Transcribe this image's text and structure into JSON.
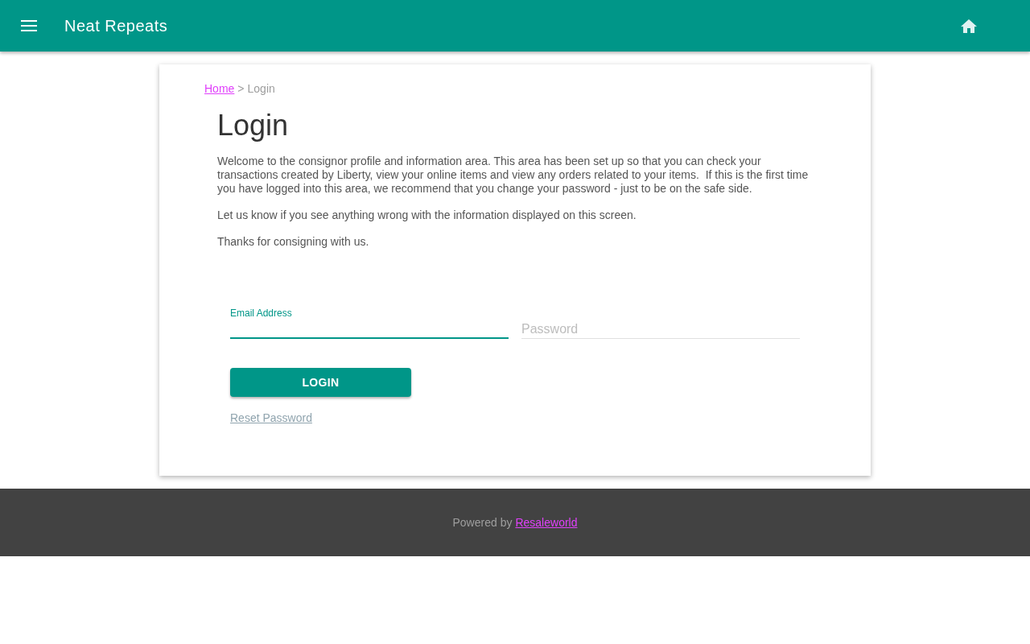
{
  "app_bar": {
    "title": "Neat Repeats"
  },
  "breadcrumb": [
    {
      "label": "Home",
      "kind": "link"
    },
    {
      "label": ">",
      "kind": "separator"
    },
    {
      "label": "Login",
      "kind": "current"
    }
  ],
  "page": {
    "heading": "Login",
    "paragraphs": [
      "Welcome to the consignor profile and information area. This area has been set up so that you can check your transactions created by Liberty, view your online items and view any orders related to your items.  If this is the first time you have logged into this area, we recommend that you change your password - just to be on the safe side.",
      "Let us know if you see anything wrong with the information displayed on this screen.",
      "Thanks for consigning with us."
    ]
  },
  "form": {
    "fields": [
      {
        "label": "Email Address",
        "focused": true
      },
      {
        "label": "Password",
        "focused": false
      }
    ],
    "login_button": "LOGIN",
    "reset_link": "Reset Password"
  },
  "footer": {
    "text": "Powered by",
    "link": "Resaleworld"
  }
}
